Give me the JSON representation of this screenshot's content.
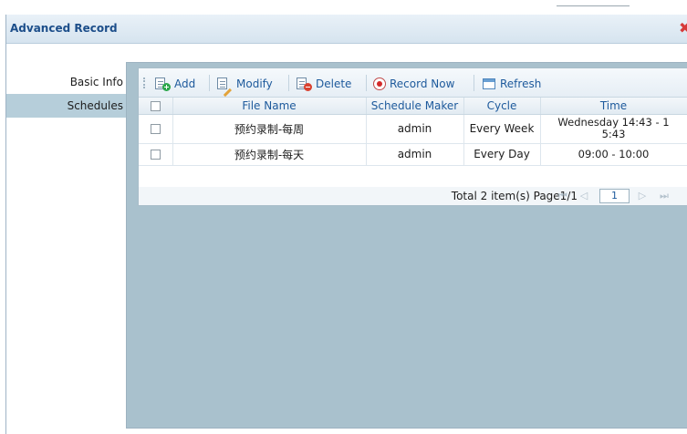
{
  "dialog": {
    "title": "Advanced Record",
    "close_glyph": "✖"
  },
  "nav": {
    "items": [
      {
        "label": "Basic Info",
        "active": false
      },
      {
        "label": "Schedules",
        "active": true
      }
    ]
  },
  "toolbar": {
    "add_label": "Add",
    "modify_label": "Modify",
    "delete_label": "Delete",
    "record_now_label": "Record Now",
    "refresh_label": "Refresh"
  },
  "table": {
    "columns": [
      "File Name",
      "Schedule Maker",
      "Cycle",
      "Time"
    ],
    "rows": [
      {
        "file_name": "预约录制-每周",
        "maker": "admin",
        "cycle": "Every Week",
        "time_line1": "Wednesday  14:43 - 1",
        "time_line2": "5:43"
      },
      {
        "file_name": "预约录制-每天",
        "maker": "admin",
        "cycle": "Every Day",
        "time_line1": "09:00 - 10:00",
        "time_line2": ""
      }
    ]
  },
  "pager": {
    "summary": "Total 2 item(s) Page1/1",
    "current_page": "1"
  },
  "icons": {
    "add": "add-document-icon",
    "modify": "edit-document-icon",
    "delete": "delete-document-icon",
    "record": "record-icon",
    "refresh": "refresh-window-icon"
  },
  "colors": {
    "content_bg": "#a9c1cd",
    "active_nav": "#b6ceda",
    "link_blue": "#1e5a9c",
    "close_red": "#d63a3a"
  }
}
